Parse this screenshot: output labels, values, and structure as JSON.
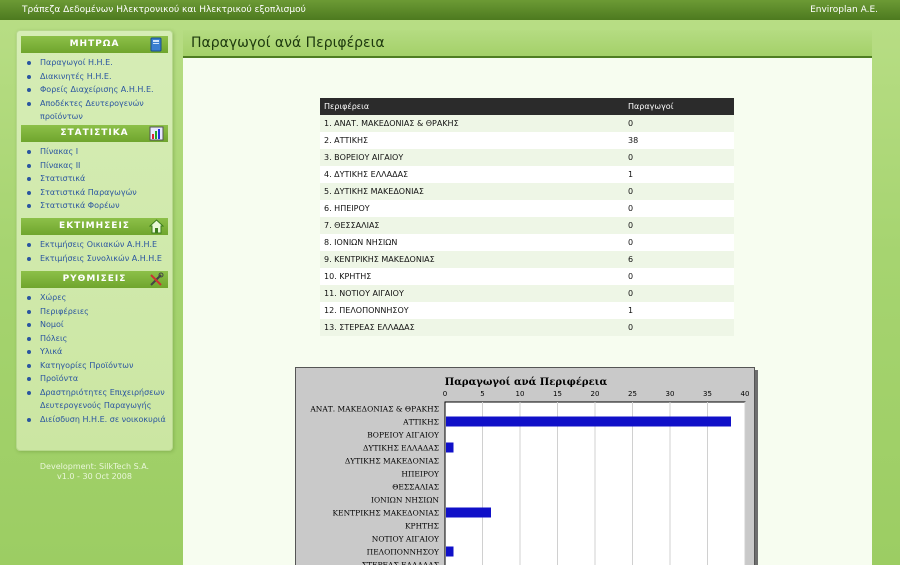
{
  "topbar": {
    "title": "Τράπεζα Δεδομένων Ηλεκτρονικού και Ηλεκτρικού εξοπλισμού",
    "company": "Enviroplan A.E."
  },
  "sidebar": {
    "sections": [
      {
        "title": "ΜΗΤΡΩΑ",
        "icon": "book-icon",
        "items": [
          "Παραγωγοί Η.Η.Ε.",
          "Διακινητές Η.Η.Ε.",
          "Φορείς Διαχείρισης Α.Η.Η.Ε.",
          "Αποδέκτες Δευτερογενών προϊόντων"
        ]
      },
      {
        "title": "ΣΤΑΤΙΣΤΙΚΑ",
        "icon": "chart-icon",
        "items": [
          "Πίνακας Ι",
          "Πίνακας ΙΙ",
          "Στατιστικά",
          "Στατιστικά Παραγωγών",
          "Στατιστικά Φορέων"
        ]
      },
      {
        "title": "ΕΚΤΙΜΗΣΕΙΣ",
        "icon": "house-icon",
        "items": [
          "Εκτιμήσεις Οικιακών Α.Η.Η.Ε",
          "Εκτιμήσεις Συνολικών Α.Η.Η.Ε"
        ]
      },
      {
        "title": "ΡΥΘΜΙΣΕΙΣ",
        "icon": "tools-icon",
        "items": [
          "Χώρες",
          "Περιφέρειες",
          "Νομοί",
          "Πόλεις",
          "Υλικά",
          "Κατηγορίες Προϊόντων",
          "Προϊόντα",
          "Δραστηριότητες Επιχειρήσεων Δευτερογενούς Παραγωγής",
          "Διείσδυση Η.Η.Ε. σε νοικοκυριά"
        ]
      }
    ],
    "credits": [
      "Development: SilkTech S.A.",
      "v1.0 - 30 Oct 2008"
    ]
  },
  "main": {
    "title": "Παραγωγοί ανά Περιφέρεια",
    "table": {
      "headers": [
        "Περιφέρεια",
        "Παραγωγοί"
      ],
      "rows": [
        [
          "1. ΑΝΑΤ. ΜΑΚΕΔΟΝΙΑΣ & ΘΡΑΚΗΣ",
          "0"
        ],
        [
          "2. ΑΤΤΙΚΗΣ",
          "38"
        ],
        [
          "3. ΒΟΡΕΙΟΥ ΑΙΓΑΙΟΥ",
          "0"
        ],
        [
          "4. ΔΥΤΙΚΗΣ ΕΛΛΑΔΑΣ",
          "1"
        ],
        [
          "5. ΔΥΤΙΚΗΣ ΜΑΚΕΔΟΝΙΑΣ",
          "0"
        ],
        [
          "6. ΗΠΕΙΡΟΥ",
          "0"
        ],
        [
          "7. ΘΕΣΣΑΛΙΑΣ",
          "0"
        ],
        [
          "8. ΙΟΝΙΩΝ ΝΗΣΙΩΝ",
          "0"
        ],
        [
          "9. ΚΕΝΤΡΙΚΗΣ ΜΑΚΕΔΟΝΙΑΣ",
          "6"
        ],
        [
          "10. ΚΡΗΤΗΣ",
          "0"
        ],
        [
          "11. ΝΟΤΙΟΥ ΑΙΓΑΙΟΥ",
          "0"
        ],
        [
          "12. ΠΕΛΟΠΟΝΝΗΣΟΥ",
          "1"
        ],
        [
          "13. ΣΤΕΡΕΑΣ ΕΛΛΑΔΑΣ",
          "0"
        ]
      ]
    }
  },
  "chart_data": {
    "type": "bar",
    "orientation": "horizontal",
    "title": "Παραγωγοί ανά Περιφέρεια",
    "categories": [
      "ΑΝΑΤ. ΜΑΚΕΔΟΝΙΑΣ & ΘΡΑΚΗΣ",
      "ΑΤΤΙΚΗΣ",
      "ΒΟΡΕΙΟΥ ΑΙΓΑΙΟΥ",
      "ΔΥΤΙΚΗΣ ΕΛΛΑΔΑΣ",
      "ΔΥΤΙΚΗΣ ΜΑΚΕΔΟΝΙΑΣ",
      "ΗΠΕΙΡΟΥ",
      "ΘΕΣΣΑΛΙΑΣ",
      "ΙΟΝΙΩΝ ΝΗΣΙΩΝ",
      "ΚΕΝΤΡΙΚΗΣ ΜΑΚΕΔΟΝΙΑΣ",
      "ΚΡΗΤΗΣ",
      "ΝΟΤΙΟΥ ΑΙΓΑΙΟΥ",
      "ΠΕΛΟΠΟΝΝΗΣΟΥ",
      "ΣΤΕΡΕΑΣ ΕΛΛΑΔΑΣ"
    ],
    "values": [
      0,
      38,
      0,
      1,
      0,
      0,
      0,
      0,
      6,
      0,
      0,
      1,
      0
    ],
    "xlim": [
      0,
      40
    ],
    "xticks": [
      0,
      5,
      10,
      15,
      20,
      25,
      30,
      35,
      40
    ],
    "bar_color": "#1010c8",
    "grid": true
  }
}
